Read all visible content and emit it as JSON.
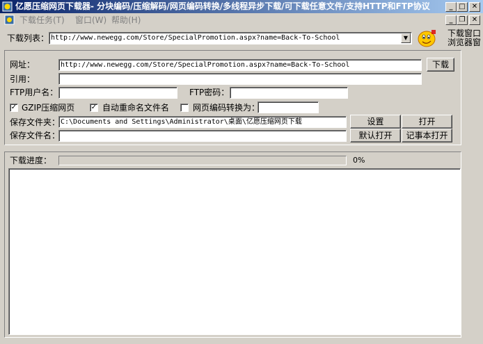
{
  "window": {
    "title": "亿愿压缩网页下载器- 分块编码/压缩解码/网页编码转换/多线程异步下载/可下载任意文件/支持HTTP和FTP协议 ..."
  },
  "menu": {
    "items": [
      {
        "label": "下载任务(T)"
      },
      {
        "label": "窗口(W)"
      },
      {
        "label": "帮助(H)"
      }
    ]
  },
  "toolbar": {
    "download_list_label": "下载列表：",
    "download_list_value": "http://www.newegg.com/Store/SpecialPromotion.aspx?name=Back-To-School",
    "side_label_1": "下载窗口",
    "side_label_2": "浏览器窗"
  },
  "form": {
    "url_label": "网址：",
    "url_value": "http://www.newegg.com/Store/SpecialPromotion.aspx?name=Back-To-School",
    "download_button": "下载",
    "referer_label": "引用：",
    "referer_value": "",
    "ftp_user_label": "FTP用户名：",
    "ftp_user_value": "",
    "ftp_pass_label": "FTP密码：",
    "ftp_pass_value": "",
    "gzip_label": "GZIP压缩网页",
    "gzip_checked": true,
    "auto_rename_label": "自动重命名文件名",
    "auto_rename_checked": true,
    "encoding_label": "网页编码转换为：",
    "encoding_checked": false,
    "encoding_value": "",
    "save_folder_label": "保存文件夹：",
    "save_folder_value": "C:\\Documents and Settings\\Administrator\\桌面\\亿愿压缩网页下载",
    "settings_button": "设置",
    "open_button": "打开",
    "save_name_label": "保存文件名：",
    "save_name_value": "",
    "default_open_button": "默认打开",
    "notepad_open_button": "记事本打开"
  },
  "progress": {
    "label": "下载进度：",
    "percent_text": "0%",
    "value": 0
  },
  "colors": {
    "titlebar_start": "#0a246a",
    "titlebar_end": "#a6caf0",
    "face": "#d4d0c8"
  }
}
